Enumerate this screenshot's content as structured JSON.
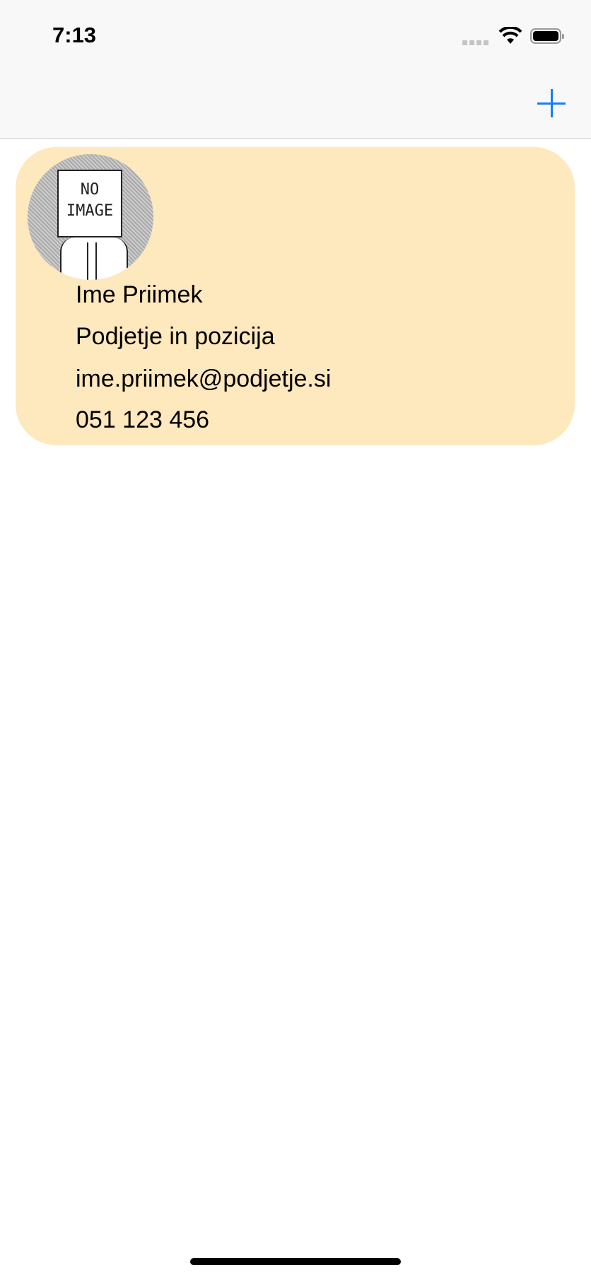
{
  "status_bar": {
    "time": "7:13",
    "icons": [
      "signal-icon",
      "wifi-icon",
      "battery-icon"
    ]
  },
  "nav_bar": {
    "add_icon": "plus-icon",
    "accent": "#157efb"
  },
  "contact_card": {
    "background": "#fee8bd",
    "avatar_text": [
      "NO",
      "IMAGE"
    ],
    "name": "Ime Priimek",
    "company_position": "Podjetje in pozicija",
    "email": "ime.priimek@podjetje.si",
    "phone": "051 123 456"
  }
}
